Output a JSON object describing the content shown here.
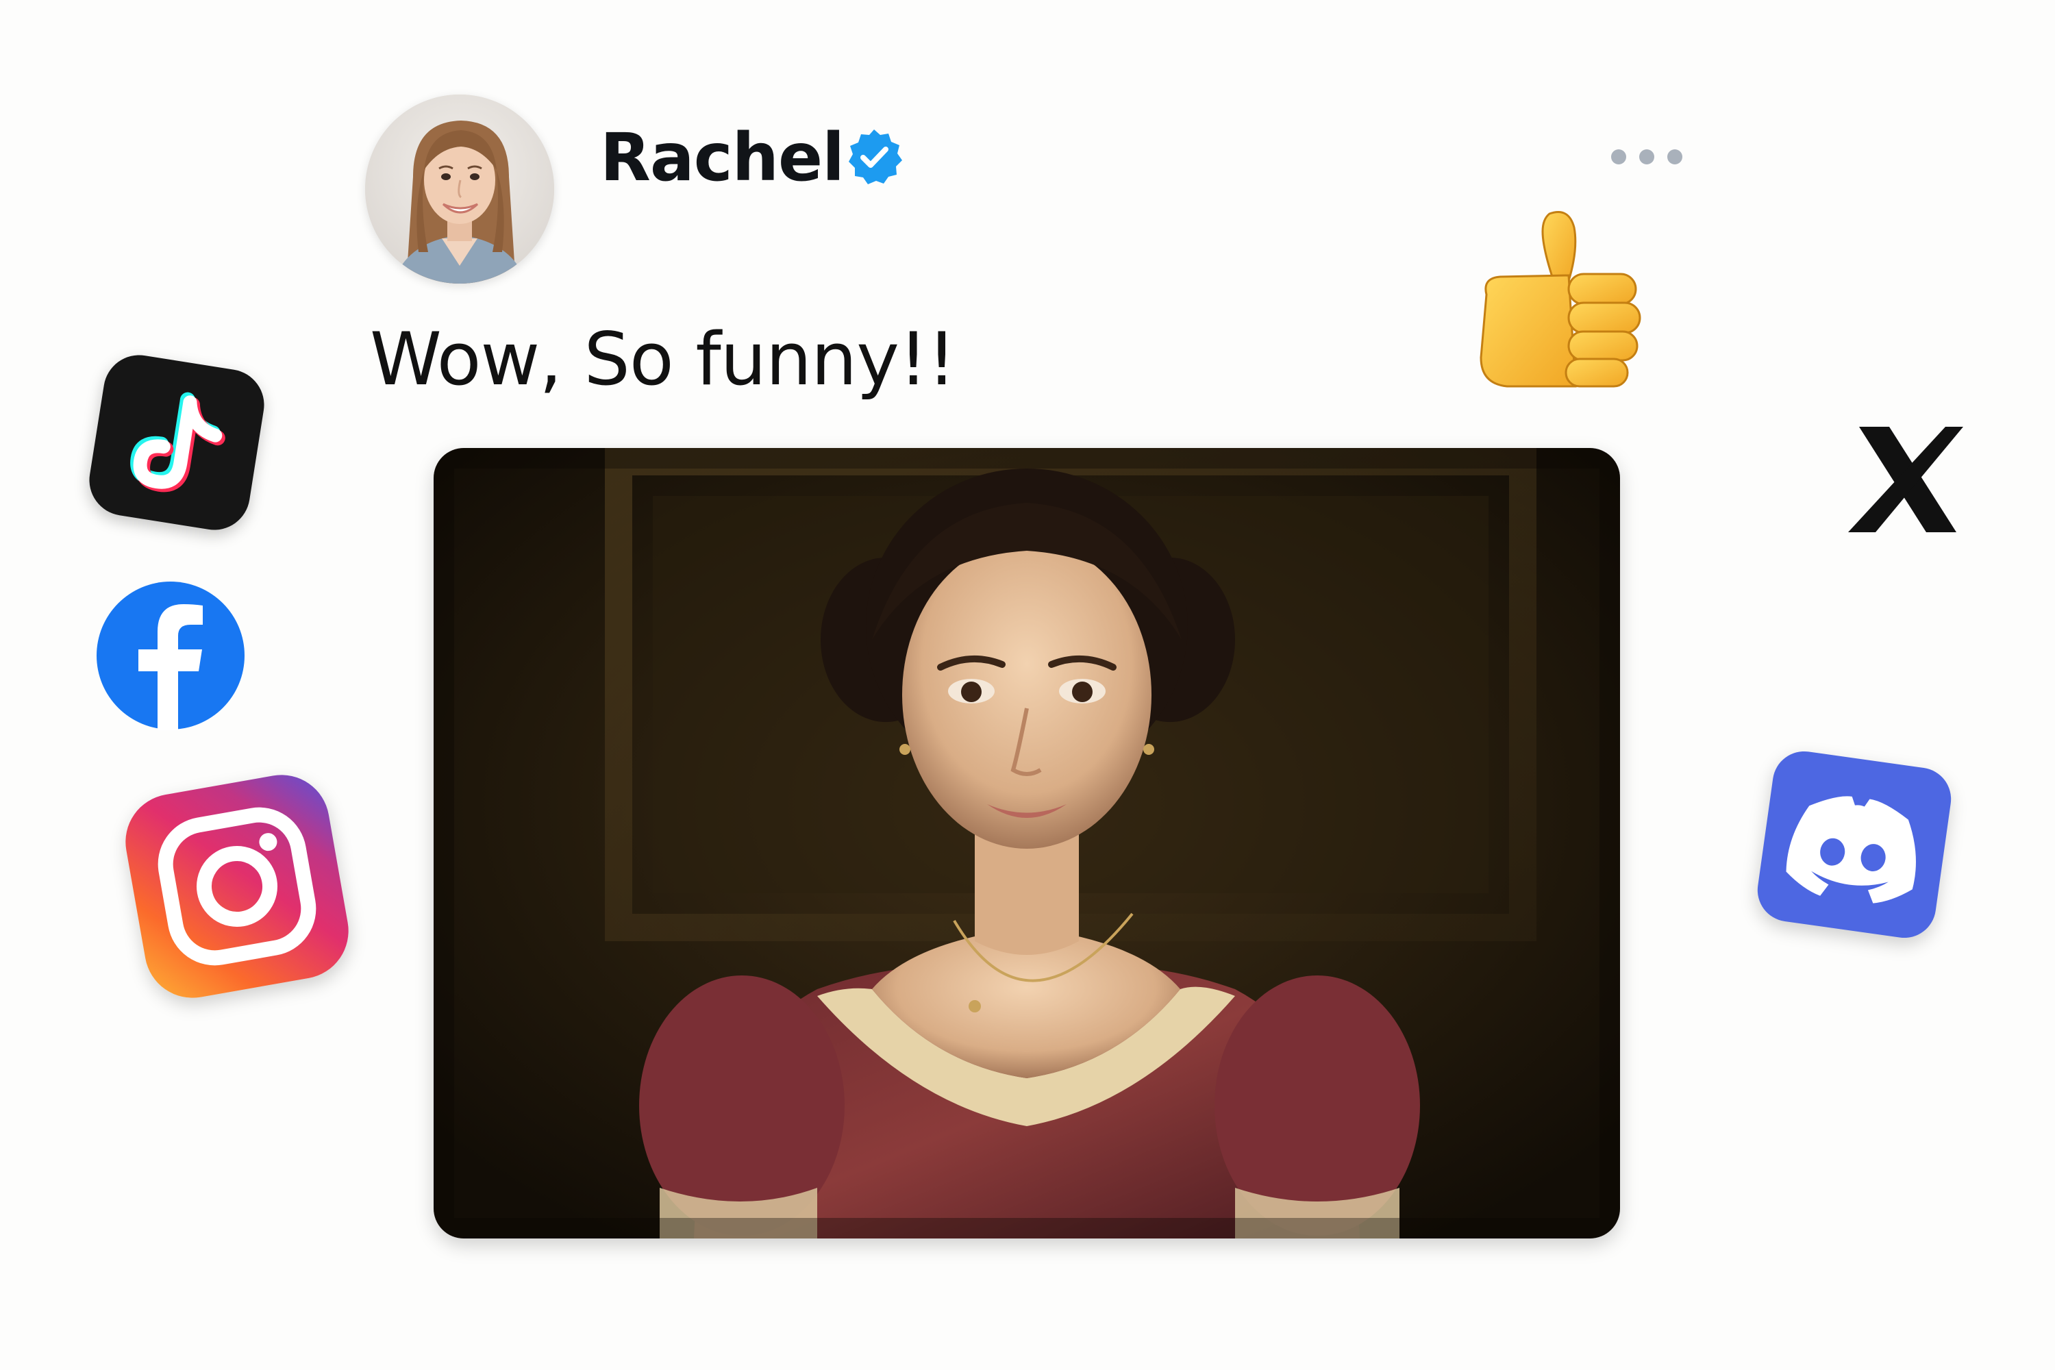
{
  "post": {
    "author": {
      "name": "Rachel",
      "verified": true,
      "avatar_icon": "user-avatar-photo"
    },
    "text": "Wow, So funny!!",
    "image_icon": "vintage-portrait-photo",
    "menu_icon": "more-options-icon"
  },
  "reaction": {
    "icon": "thumbs-up-emoji"
  },
  "social_icons": [
    {
      "name": "TikTok",
      "icon": "tiktok-icon"
    },
    {
      "name": "Facebook",
      "icon": "facebook-icon"
    },
    {
      "name": "Instagram",
      "icon": "instagram-icon"
    },
    {
      "name": "X",
      "icon": "x-icon"
    },
    {
      "name": "Discord",
      "icon": "discord-icon"
    }
  ],
  "colors": {
    "background": "#fdfdfc",
    "verified_badge": "#1d9bf0",
    "text": "#111418",
    "menu_dots": "#a9b1bb",
    "facebook": "#1877f2",
    "discord": "#4d67e2",
    "tiktok_bg": "#161616"
  }
}
